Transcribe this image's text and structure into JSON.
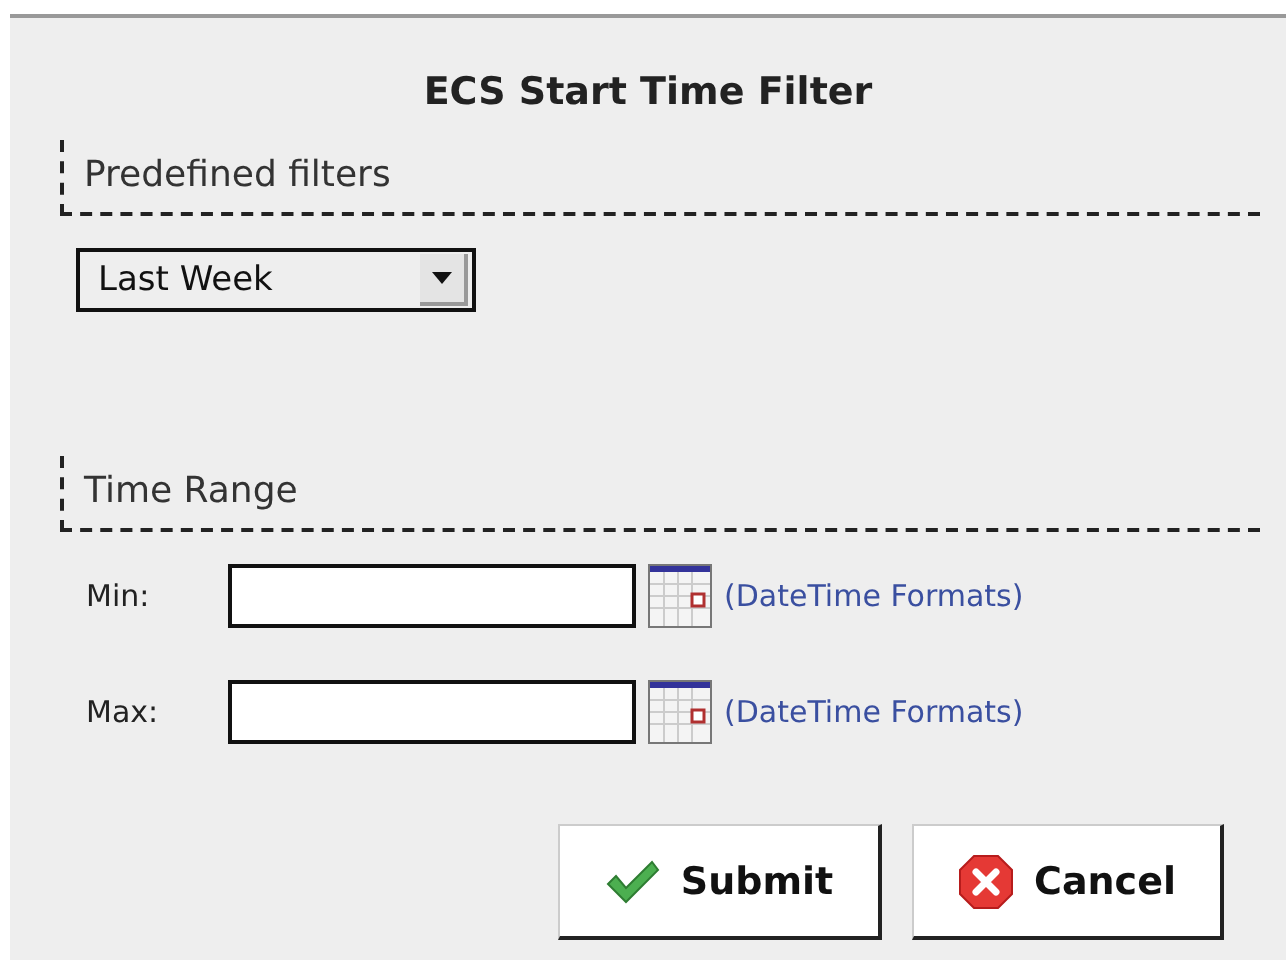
{
  "dialog": {
    "title": "ECS Start Time Filter"
  },
  "predefined_filters": {
    "legend": "Predefined filters",
    "dropdown": {
      "value": "Last Week"
    }
  },
  "time_range": {
    "legend": "Time Range",
    "rows": [
      {
        "label": "Min:",
        "value": "",
        "link_open": "(",
        "link": "DateTime Formats",
        "link_close": ")"
      },
      {
        "label": "Max:",
        "value": "",
        "link_open": "(",
        "link": "DateTime Formats",
        "link_close": ")"
      }
    ]
  },
  "buttons": [
    {
      "kind": "submit",
      "label": "Submit"
    },
    {
      "kind": "cancel",
      "label": "Cancel"
    }
  ]
}
